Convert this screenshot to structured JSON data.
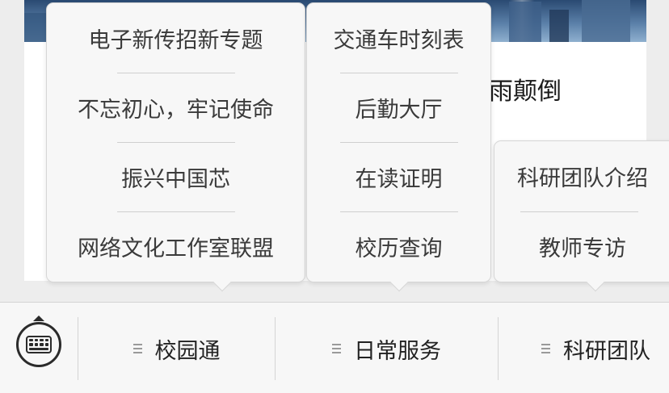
{
  "article": {
    "title": "大雨颠倒"
  },
  "popups": [
    {
      "items": [
        "电子新传招新专题",
        "不忘初心，牢记使命",
        "振兴中国芯",
        "网络文化工作室联盟"
      ]
    },
    {
      "items": [
        "交通车时刻表",
        "后勤大厅",
        "在读证明",
        "校历查询"
      ]
    },
    {
      "items": [
        "科研团队介绍",
        "教师专访"
      ]
    }
  ],
  "menu_bar": {
    "keyboard_icon": "keyboard-toggle-icon",
    "menu_icon": "menu-lines-icon",
    "tabs": [
      {
        "label": "校园通"
      },
      {
        "label": "日常服务"
      },
      {
        "label": "科研团队"
      }
    ]
  }
}
